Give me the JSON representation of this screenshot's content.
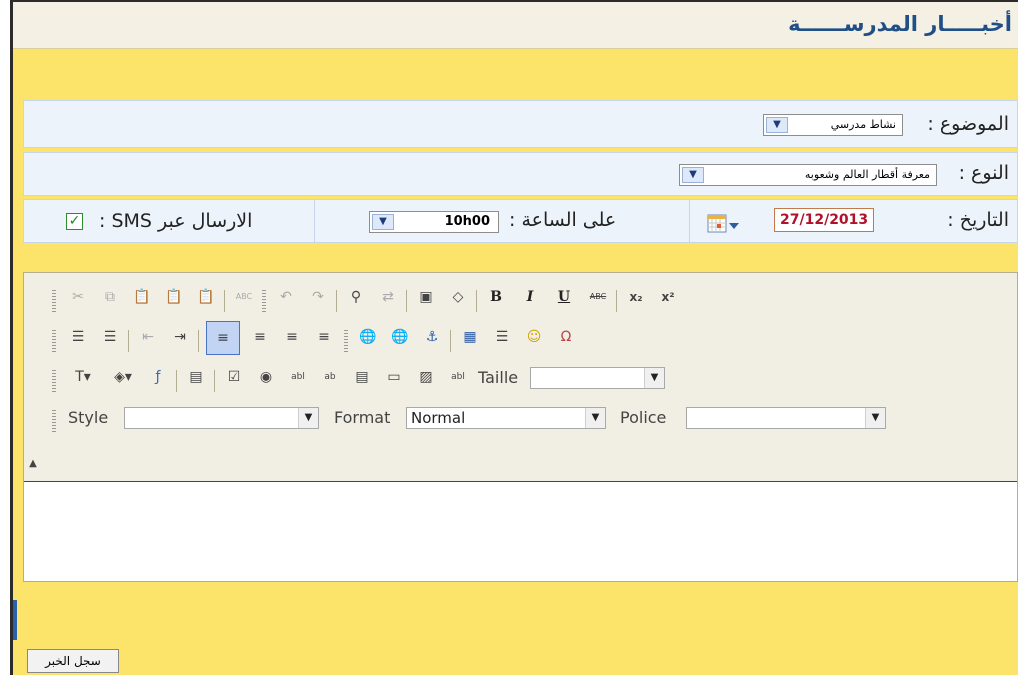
{
  "page": {
    "title": "أخبـــــار المدرســــــة"
  },
  "form": {
    "subject": {
      "label": "الموضوع :",
      "value": "نشاط مدرسي"
    },
    "type": {
      "label": "النوع :",
      "value": "معرفة أقطار العالم وشعوبه"
    },
    "date": {
      "label": "التاريخ :",
      "value": "27/12/2013",
      "picker_icon": "calendar-icon"
    },
    "time": {
      "label": "على الساعة :",
      "value": "10h00"
    },
    "sms": {
      "label": "الارسال عبر SMS :",
      "checked": true
    }
  },
  "editor": {
    "row1": [
      "cut",
      "copy",
      "paste",
      "paste-text",
      "paste-word",
      "spellcheck",
      "undo",
      "redo",
      "find",
      "replace",
      "select-all",
      "remove-format",
      "bold",
      "italic",
      "underline",
      "strike",
      "subscript",
      "superscript"
    ],
    "row2": [
      "numbered-list",
      "bulleted-list",
      "outdent",
      "indent",
      "align-left",
      "align-center",
      "align-right",
      "justify",
      "link",
      "unlink",
      "anchor",
      "table",
      "horizontal-rule",
      "smiley",
      "special-char"
    ],
    "row3": [
      "text-color",
      "bg-color",
      "flash",
      "form",
      "checkbox",
      "radio",
      "text-field",
      "textarea",
      "select-field",
      "button",
      "image-button",
      "hidden-field"
    ],
    "glyphs": {
      "bold": "B",
      "italic": "I",
      "underline": "U",
      "strike": "ABC",
      "subscript": "x₂",
      "superscript": "x²",
      "spellcheck": "ABC"
    },
    "taille_label": "Taille",
    "style_label": "Style",
    "format_label": "Format",
    "format_value": "Normal",
    "police_label": "Police",
    "active_button": "align-left"
  },
  "submit": {
    "label": "سجل الخبر"
  },
  "colors": {
    "background": "#fce36a",
    "title": "#1f4f86",
    "row": "#edf3fb",
    "date": "#b0122a"
  }
}
